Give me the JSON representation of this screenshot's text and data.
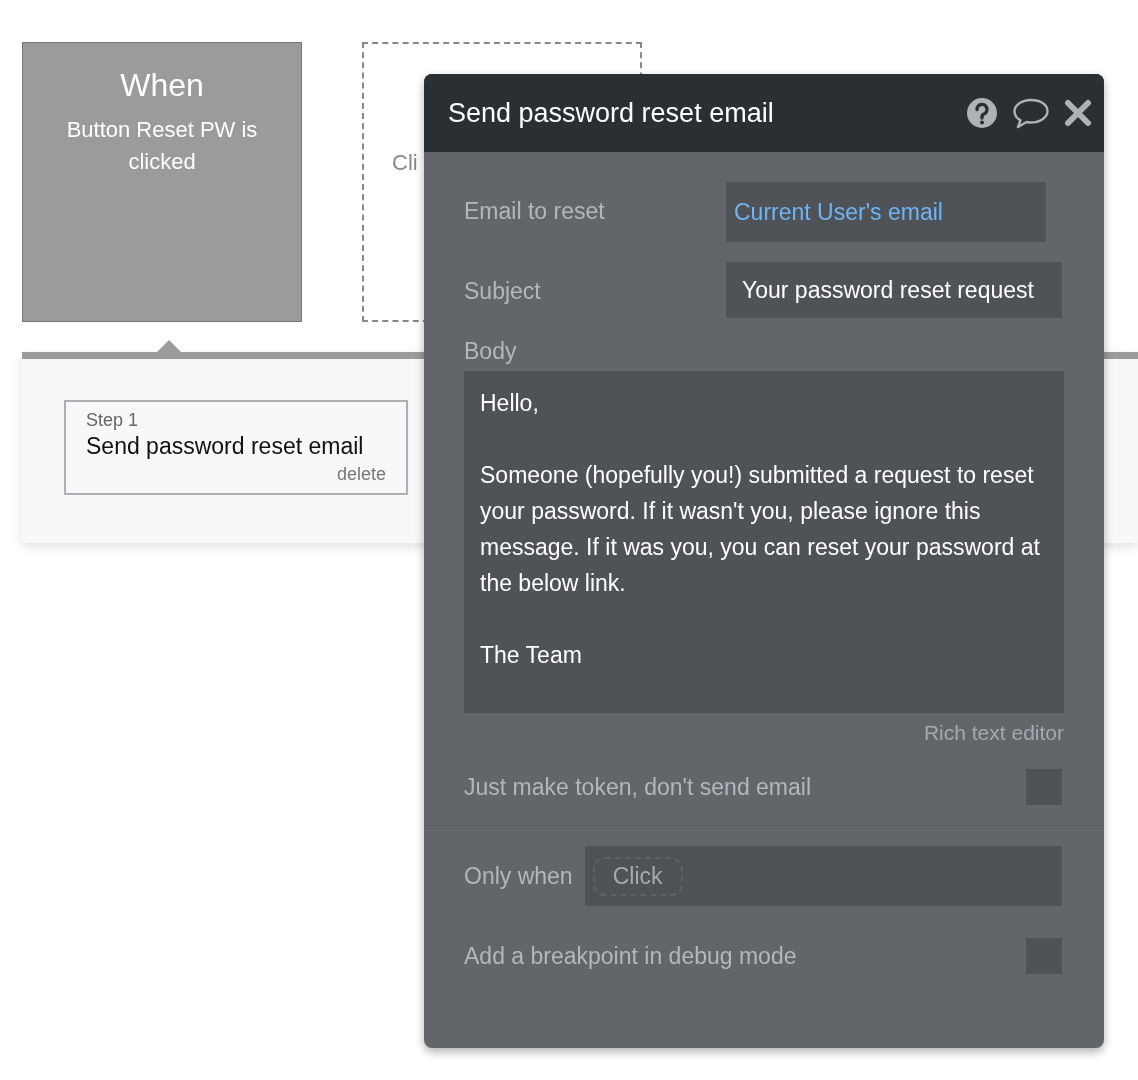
{
  "event_card": {
    "title": "When",
    "description": "Button Reset PW is clicked"
  },
  "action_placeholder": {
    "label": "Cli"
  },
  "steps": [
    {
      "label": "Step 1",
      "title": "Send password reset email",
      "delete": "delete",
      "selected": true
    }
  ],
  "popup": {
    "title": "Send password reset email",
    "fields": [
      {
        "kind": "dynamic",
        "label": "Email to reset",
        "value": "Current User's email"
      },
      {
        "kind": "text",
        "label": "Subject",
        "value": "Your password reset request"
      }
    ],
    "body": {
      "label": "Body",
      "paragraphs": [
        "Hello,",
        "Someone (hopefully you!) submitted a request to reset your password. If it wasn't you, please ignore this message. If it was you, you can reset your password at the below link.",
        "The Team"
      ],
      "editor_link": "Rich text editor"
    },
    "token_option": {
      "label": "Just make token, don't send email",
      "checked": false
    },
    "only_when": {
      "label": "Only when",
      "placeholder": "Click"
    },
    "breakpoint_option": {
      "label": "Add a breakpoint in debug mode",
      "checked": false
    }
  }
}
